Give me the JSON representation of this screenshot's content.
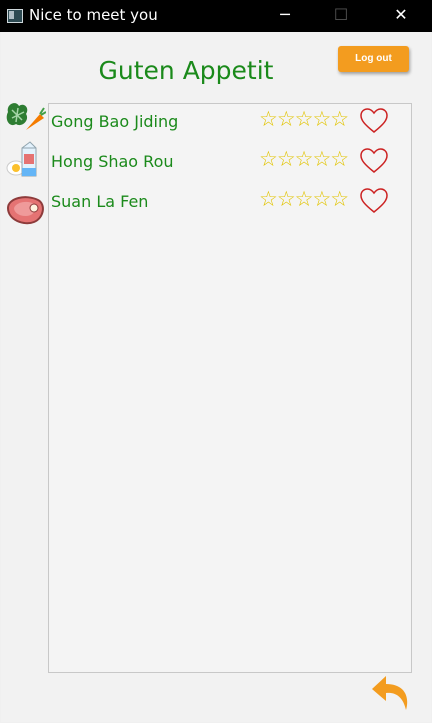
{
  "window": {
    "title": "Nice to meet you",
    "controls": {
      "minimize": "─",
      "maximize": "☐",
      "close": "✕"
    }
  },
  "header": {
    "heading": "Guten Appetit",
    "logout_label": "Log out"
  },
  "categories": [
    {
      "icon": "vegetables-icon"
    },
    {
      "icon": "milk-egg-icon"
    },
    {
      "icon": "meat-icon"
    }
  ],
  "dishes": [
    {
      "name": "Gong Bao Jiding",
      "rating": 0,
      "rating_max": 5,
      "favorite": false
    },
    {
      "name": "Hong Shao Rou",
      "rating": 0,
      "rating_max": 5,
      "favorite": false
    },
    {
      "name": "Suan La Fen",
      "rating": 0,
      "rating_max": 5,
      "favorite": false
    }
  ],
  "footer": {
    "back_icon": "back-arrow-icon"
  },
  "colors": {
    "heading": "#1b8a1b",
    "accent": "#f39c1f",
    "star": "#e2c400",
    "heart": "#cc2222",
    "titlebar": "#000000"
  }
}
